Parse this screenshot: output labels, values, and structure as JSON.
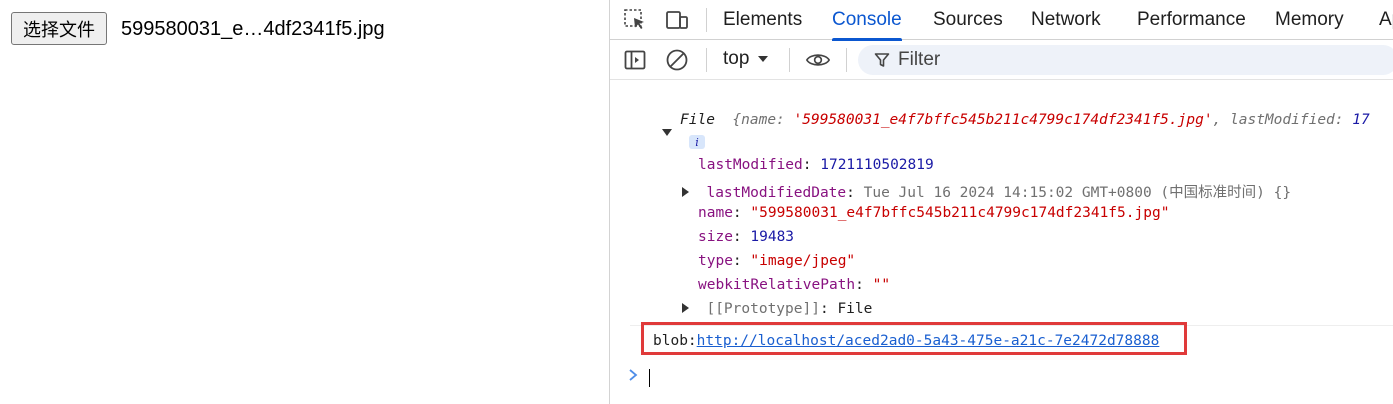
{
  "page": {
    "file_button_label": "选择文件",
    "file_name": "599580031_e…4df2341f5.jpg"
  },
  "devtools": {
    "tabs": [
      {
        "label": "Elements"
      },
      {
        "label": "Console"
      },
      {
        "label": "Sources"
      },
      {
        "label": "Network"
      },
      {
        "label": "Performance"
      },
      {
        "label": "Memory"
      },
      {
        "label": "Ap"
      }
    ],
    "active_tab": "Console",
    "toolbar": {
      "context": "top",
      "filter_placeholder": "Filter"
    },
    "console": {
      "object_type": "File",
      "preview_key1": "name",
      "preview_val1": "'599580031_e4f7bffc545b211c4799c174df2341f5.jpg'",
      "preview_key2": "lastModified",
      "preview_val2": "17",
      "info_badge": "i",
      "props": [
        {
          "key": "lastModified",
          "value": "1721110502819",
          "kind": "number",
          "expandable": false
        },
        {
          "key": "lastModifiedDate",
          "value": "Tue Jul 16 2024 14:15:02 GMT+0800 (中国标准时间)  {}",
          "kind": "date",
          "expandable": true
        },
        {
          "key": "name",
          "value": "\"599580031_e4f7bffc545b211c4799c174df2341f5.jpg\"",
          "kind": "string",
          "expandable": false
        },
        {
          "key": "size",
          "value": "19483",
          "kind": "number",
          "expandable": false
        },
        {
          "key": "type",
          "value": "\"image/jpeg\"",
          "kind": "string",
          "expandable": false
        },
        {
          "key": "webkitRelativePath",
          "value": "\"\"",
          "kind": "string",
          "expandable": false
        },
        {
          "key": "[[Prototype]]",
          "value": "File",
          "kind": "plain",
          "expandable": true
        }
      ],
      "blob_prefix": "blob:",
      "blob_url": "http://localhost/aced2ad0-5a43-475e-a21c-7e2472d78888"
    }
  },
  "colors": {
    "active_tab": "#0b57d0",
    "highlight_box": "#e03a3a",
    "key": "#881280",
    "number": "#1a1aa6",
    "string": "#c80000"
  },
  "icons": [
    "inspect-element-icon",
    "device-toolbar-icon",
    "sidebar-toggle-icon",
    "clear-console-icon",
    "dropdown-arrow-icon",
    "eye-icon",
    "filter-icon",
    "prompt-chevron-icon"
  ]
}
